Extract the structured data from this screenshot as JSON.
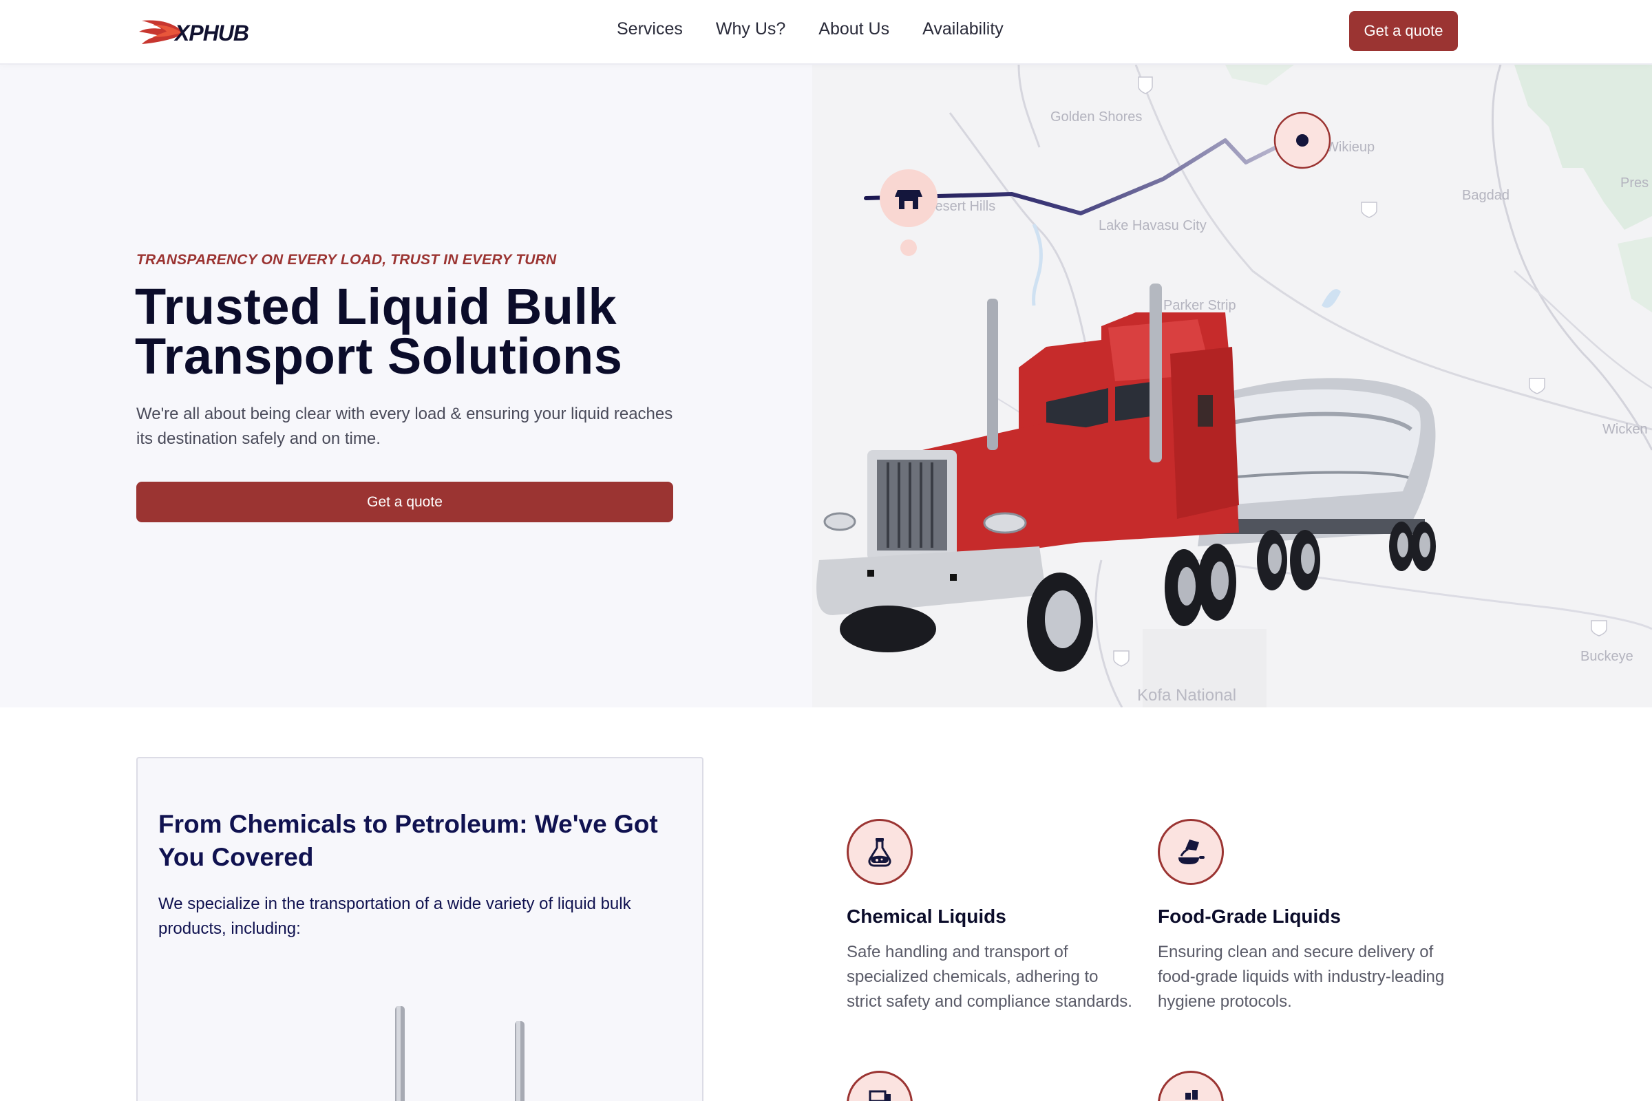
{
  "brand": {
    "name": "XPHUB"
  },
  "nav": {
    "items": [
      {
        "label": "Services"
      },
      {
        "label": "Why Us?"
      },
      {
        "label": "About Us"
      },
      {
        "label": "Availability"
      }
    ],
    "cta_label": "Get a quote"
  },
  "hero": {
    "eyebrow": "TRANSPARENCY ON EVERY LOAD, TRUST IN EVERY TURN",
    "title": "Trusted Liquid Bulk Transport Solutions",
    "description": "We're all about being clear with every load & ensuring your liquid reaches its destination safely and on time.",
    "cta_label": "Get a quote",
    "map_labels": {
      "golden_shores": "Golden Shores",
      "wikieup": "Wikieup",
      "bagdad": "Bagdad",
      "lake_havasu": "Lake Havasu City",
      "parker_strip": "Parker Strip",
      "wickenburg": "Wicken",
      "buckeye": "Buckeye",
      "kofa": "Kofa National",
      "desert": "Desert Hills",
      "prescott": "Pres"
    }
  },
  "services": {
    "card_title": "From Chemicals to Petroleum: We've Got You Covered",
    "card_desc": "We specialize in the transportation of a wide variety of liquid bulk products, including:",
    "items": [
      {
        "title": "Chemical Liquids",
        "desc": "Safe handling and transport of specialized chemicals, adhering to strict safety and compliance standards.",
        "icon": "flask-icon"
      },
      {
        "title": "Food-Grade Liquids",
        "desc": "Ensuring clean and secure delivery of food-grade liquids with industry-leading hygiene protocols.",
        "icon": "pouring-icon"
      }
    ]
  },
  "colors": {
    "accent": "#9b3432",
    "navy": "#0b0c2a",
    "hero_bg": "#f7f7fb",
    "icon_bg": "#fbe3e0"
  }
}
